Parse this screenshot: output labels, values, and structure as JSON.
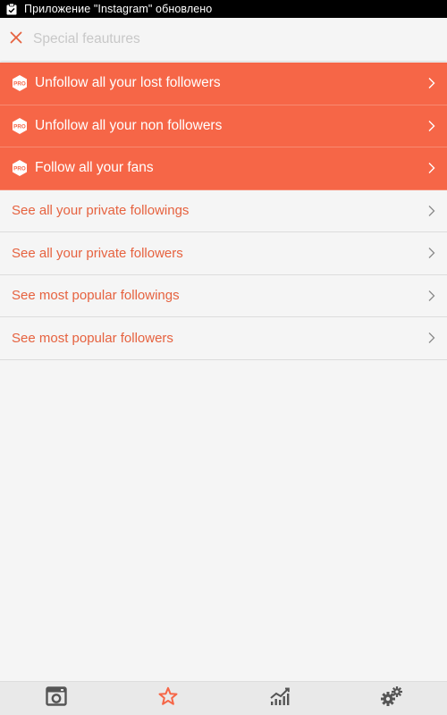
{
  "status_bar": {
    "notification_text": "Приложение \"Instagram\" обновлено",
    "icon": "clipboard-check-icon"
  },
  "header": {
    "title": "Special feautures",
    "close_icon": "close-icon"
  },
  "pro_items": [
    {
      "label": "Unfollow all your lost followers",
      "badge": "PRO"
    },
    {
      "label": "Unfollow all your non followers",
      "badge": "PRO"
    },
    {
      "label": "Follow all your fans",
      "badge": "PRO"
    }
  ],
  "items": [
    {
      "label": "See all your private followings"
    },
    {
      "label": "See all your private followers"
    },
    {
      "label": "See most popular followings"
    },
    {
      "label": "See most popular followers"
    }
  ],
  "bottom_nav": [
    {
      "icon": "photo-camera-icon",
      "active": false
    },
    {
      "icon": "star-icon",
      "active": true
    },
    {
      "icon": "chart-icon",
      "active": false
    },
    {
      "icon": "settings-gears-icon",
      "active": false
    }
  ],
  "colors": {
    "accent": "#f66647",
    "accent_text": "#e6623f",
    "nav_icon": "#555555"
  }
}
